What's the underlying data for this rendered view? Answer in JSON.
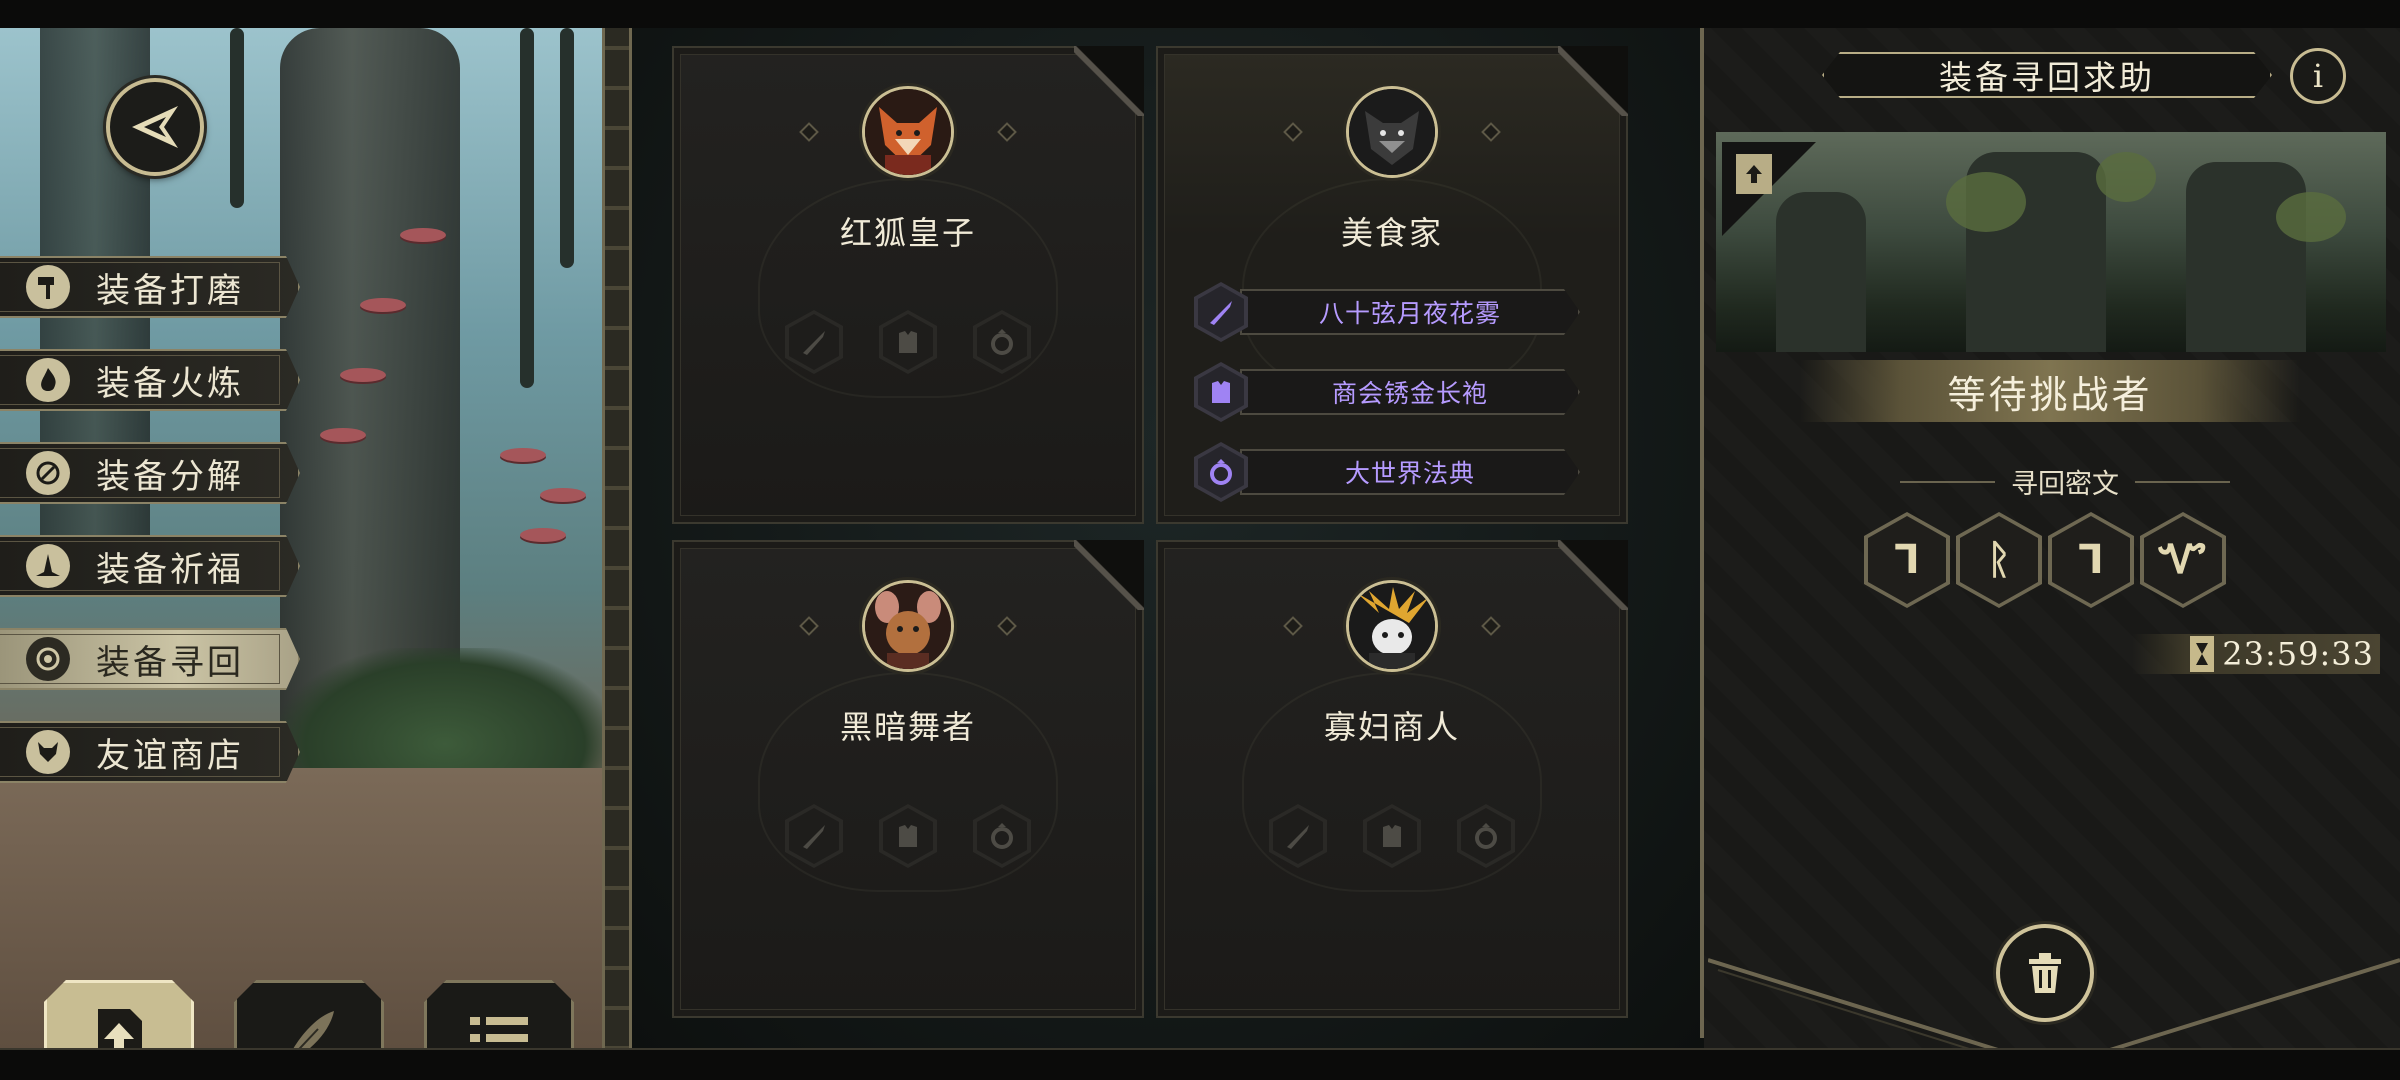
{
  "menu": {
    "items": [
      {
        "label": "装备打磨",
        "icon": "hammer-icon",
        "active": false
      },
      {
        "label": "装备火炼",
        "icon": "flame-icon",
        "active": false
      },
      {
        "label": "装备分解",
        "icon": "disassemble-icon",
        "active": false
      },
      {
        "label": "装备祈福",
        "icon": "pray-icon",
        "active": false
      },
      {
        "label": "装备寻回",
        "icon": "retrieve-icon",
        "active": true
      },
      {
        "label": "友谊商店",
        "icon": "fox-icon",
        "active": false
      }
    ]
  },
  "bottom_buttons": [
    {
      "icon": "upload-icon",
      "active": true
    },
    {
      "icon": "feather-icon",
      "active": false
    },
    {
      "icon": "list-icon",
      "active": false
    }
  ],
  "cards": [
    {
      "name": "红狐皇子",
      "avatar": "red-fox-portrait",
      "equipment": []
    },
    {
      "name": "美食家",
      "avatar": "gourmet-portrait",
      "equipment": [
        {
          "label": "八十弦月夜花雾",
          "icon": "sword-icon"
        },
        {
          "label": "商会锈金长袍",
          "icon": "armor-icon"
        },
        {
          "label": "大世界法典",
          "icon": "ring-icon"
        }
      ]
    },
    {
      "name": "黑暗舞者",
      "avatar": "dark-dancer-portrait",
      "equipment": []
    },
    {
      "name": "寡妇商人",
      "avatar": "widow-merchant-portrait",
      "equipment": []
    }
  ],
  "right": {
    "title": "装备寻回求助",
    "status": "等待挑战者",
    "cipher_title": "寻回密文",
    "ciphers": [
      "Ꞁ",
      "ᚱ",
      "Ꞁ",
      "Ꮙ"
    ],
    "timer": "23:59:33"
  },
  "colors": {
    "accent_gold": "#c8bc92",
    "equipment_text": "#b69bff",
    "panel_dark": "#1b1a18"
  }
}
